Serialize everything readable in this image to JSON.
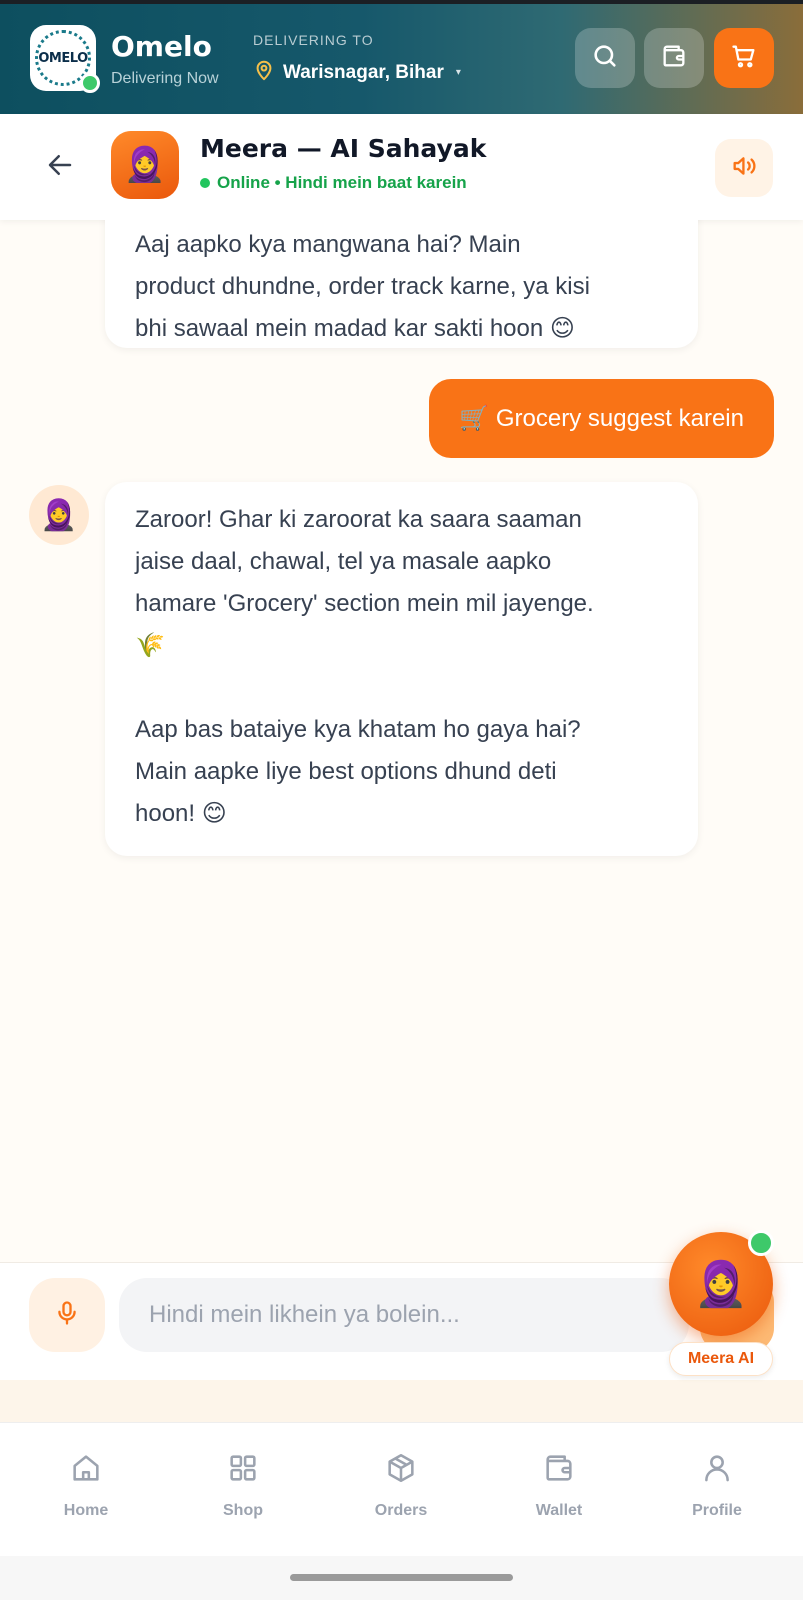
{
  "header": {
    "logo_text": "OMELO",
    "brand_name": "Omelo",
    "brand_sub": "Delivering Now",
    "deliver_label": "DELIVERING TO",
    "deliver_location": "Warisnagar, Bihar",
    "caret": "▾",
    "buttons": [
      "search-icon",
      "wallet-icon",
      "cart-icon"
    ]
  },
  "chat_header": {
    "avatar": "🧕",
    "title": "Meera — AI Sahayak",
    "status": "Online • Hindi mein baat karein"
  },
  "messages": [
    {
      "role": "bot",
      "text": "Aaj aapko kya mangwana hai? Main\nproduct dhundne, order track karne, ya kisi\nbhi sawaal mein madad kar sakti hoon 😊"
    },
    {
      "role": "user",
      "text": "🛒 Grocery suggest karein"
    },
    {
      "role": "bot",
      "avatar": "🧕",
      "text": "Zaroor! Ghar ki zaroorat ka saara saaman\njaise daal, chawal, tel ya masale aapko\nhamare 'Grocery' section mein mil jayenge.\n🌾\n\nAap bas bataiye kya khatam ho gaya hai?\nMain aapke liye best options dhund deti\nhoon! 😊"
    }
  ],
  "input": {
    "placeholder": "Hindi mein likhein ya bolein...",
    "value": ""
  },
  "fab": {
    "avatar": "🧕",
    "label": "Meera AI"
  },
  "nav": {
    "items": [
      {
        "label": "Home",
        "icon": "home-icon"
      },
      {
        "label": "Shop",
        "icon": "grid-icon"
      },
      {
        "label": "Orders",
        "icon": "box-icon"
      },
      {
        "label": "Wallet",
        "icon": "wallet-icon"
      },
      {
        "label": "Profile",
        "icon": "user-icon"
      }
    ]
  },
  "colors": {
    "accent": "#f97316",
    "online": "#16a34a",
    "header_dark": "#0d4f5f"
  }
}
